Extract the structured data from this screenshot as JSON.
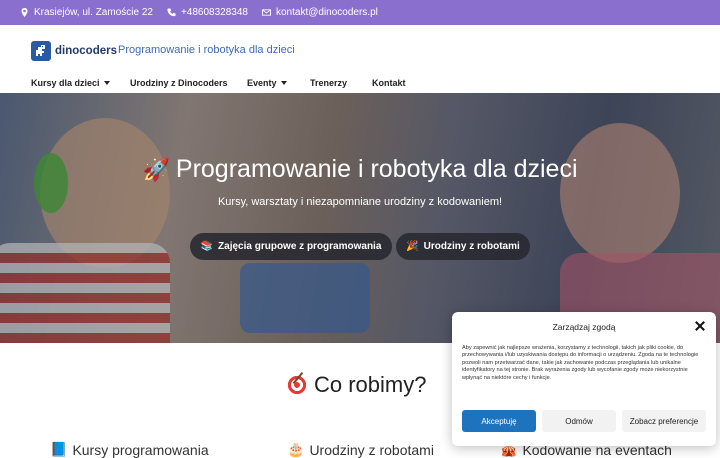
{
  "topbar": {
    "address": "Krasiejów, ul. Zamoście 22",
    "phone": "+48608328348",
    "email": "kontakt@dinocoders.pl",
    "background": "#8b6fcf"
  },
  "header": {
    "logo_text": "dinocoders",
    "tagline": "Programowanie i robotyka dla dzieci"
  },
  "nav": {
    "items": [
      {
        "label": "Kursy dla dzieci",
        "has_dropdown": true
      },
      {
        "label": "Urodziny z Dinocoders",
        "has_dropdown": false
      },
      {
        "label": "Eventy",
        "has_dropdown": true
      },
      {
        "label": "Trenerzy",
        "has_dropdown": false
      },
      {
        "label": "Kontakt",
        "has_dropdown": false
      }
    ]
  },
  "hero": {
    "title_icon": "🚀",
    "title": "Programowanie i robotyka dla dzieci",
    "subtitle": "Kursy, warsztaty i niezapomniane urodziny z kodowaniem!",
    "buttons": [
      {
        "icon": "📚",
        "label": "Zajęcia grupowe z programowania"
      },
      {
        "icon": "🎉",
        "label": "Urodziny z robotami"
      }
    ]
  },
  "section": {
    "title": "Co robimy?",
    "cards": [
      {
        "icon": "📘",
        "title": "Kursy programowania"
      },
      {
        "icon": "🎂",
        "title": "Urodziny z robotami"
      },
      {
        "icon": "🎪",
        "title": "Kodowanie na eventach"
      }
    ]
  },
  "consent": {
    "title": "Zarządzaj zgodą",
    "text": "Aby zapewnić jak najlepsze wrażenia, korzystamy z technologii, takich jak pliki cookie, do przechowywania i/lub uzyskiwania dostępu do informacji o urządzeniu. Zgoda na te technologie pozwoli nam przetwarzać dane, takie jak zachowanie podczas przeglądania lub unikalne identyfikatory na tej stronie. Brak wyrażenia zgody lub wycofanie zgody może niekorzystnie wpłynąć na niektóre cechy i funkcje.",
    "accept_label": "Akceptuję",
    "deny_label": "Odmów",
    "prefs_label": "Zobacz preferencje",
    "accent": "#1e73be"
  }
}
